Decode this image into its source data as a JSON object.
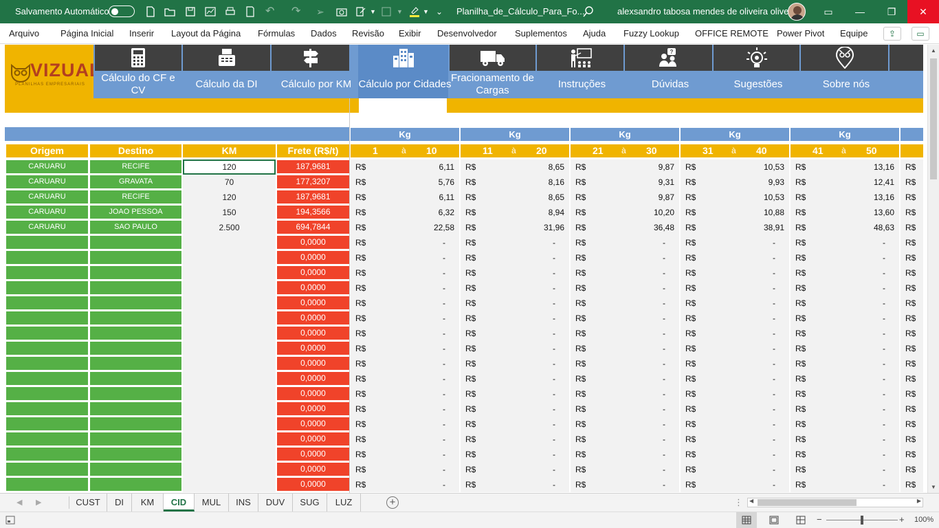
{
  "titlebar": {
    "autosave_label": "Salvamento Automático",
    "filename": "Planilha_de_Cálculo_Para_Fo...",
    "user": "alexsandro tabosa mendes de oliveira oliveira"
  },
  "menu": [
    "Arquivo",
    "Página Inicial",
    "Inserir",
    "Layout da Página",
    "Fórmulas",
    "Dados",
    "Revisão",
    "Exibir",
    "Desenvolvedor",
    "Suplementos",
    "Ajuda",
    "Fuzzy Lookup",
    "OFFICE REMOTE",
    "Power Pivot",
    "Equipe"
  ],
  "logo": {
    "name": "VIZUAL",
    "tagline": "PLANILHAS EMPRESARIAIS"
  },
  "nav": [
    {
      "label": "Cálculo do CF e CV",
      "icon": "calculator-icon"
    },
    {
      "label": "Cálculo da DI",
      "icon": "cash-register-icon"
    },
    {
      "label": "Cálculo por KM",
      "icon": "signpost-icon"
    },
    {
      "label": "Cálculo por Cidades",
      "icon": "city-buildings-icon"
    },
    {
      "label": "Fracionamento de Cargas",
      "icon": "truck-icon"
    },
    {
      "label": "Instruções",
      "icon": "teacher-board-icon"
    },
    {
      "label": "Dúvidas",
      "icon": "question-people-icon"
    },
    {
      "label": "Sugestões",
      "icon": "lightbulb-gear-icon"
    },
    {
      "label": "Sobre nós",
      "icon": "owl-location-icon"
    }
  ],
  "table": {
    "headers": {
      "origem": "Origem",
      "destino": "Destino",
      "km": "KM",
      "frete": "Frete (R$/t)"
    },
    "kg_label": "Kg",
    "ranges": [
      [
        "1",
        "à",
        "10"
      ],
      [
        "11",
        "à",
        "20"
      ],
      [
        "21",
        "à",
        "30"
      ],
      [
        "31",
        "à",
        "40"
      ],
      [
        "41",
        "à",
        "50"
      ]
    ],
    "currency": "R$",
    "rows": [
      {
        "origem": "CARUARU",
        "destino": "RECIFE",
        "km": "120",
        "frete": "187,9681",
        "vals": [
          "6,11",
          "8,65",
          "9,87",
          "10,53",
          "13,16"
        ]
      },
      {
        "origem": "CARUARU",
        "destino": "GRAVATA",
        "km": "70",
        "frete": "177,3207",
        "vals": [
          "5,76",
          "8,16",
          "9,31",
          "9,93",
          "12,41"
        ]
      },
      {
        "origem": "CARUARU",
        "destino": "RECIFE",
        "km": "120",
        "frete": "187,9681",
        "vals": [
          "6,11",
          "8,65",
          "9,87",
          "10,53",
          "13,16"
        ]
      },
      {
        "origem": "CARUARU",
        "destino": "JOAO PESSOA",
        "km": "150",
        "frete": "194,3566",
        "vals": [
          "6,32",
          "8,94",
          "10,20",
          "10,88",
          "13,60"
        ]
      },
      {
        "origem": "CARUARU",
        "destino": "SAO PAULO",
        "km": "2.500",
        "frete": "694,7844",
        "vals": [
          "22,58",
          "31,96",
          "36,48",
          "38,91",
          "48,63"
        ]
      }
    ],
    "empty_frete": "0,0000",
    "empty_val": "-",
    "empty_row_count": 17
  },
  "sheet_tabs": [
    "CUST",
    "DI",
    "KM",
    "CID",
    "MUL",
    "INS",
    "DUV",
    "SUG",
    "LUZ"
  ],
  "active_tab": "CID",
  "zoom": "100%"
}
